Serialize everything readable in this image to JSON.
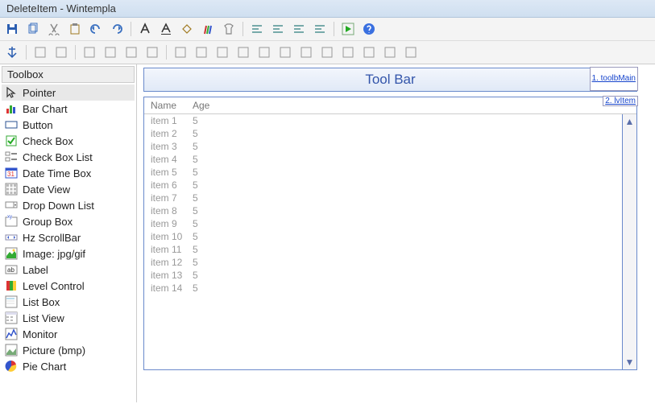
{
  "window": {
    "title": "DeleteItem  -  Wintempla"
  },
  "toolbar1_icons": [
    "save",
    "copy",
    "cut",
    "paste",
    "undo",
    "redo",
    "sep",
    "font-a",
    "font-underline",
    "fill",
    "pencils",
    "tshirt",
    "sep",
    "align-left",
    "align-center",
    "align-right",
    "align-stack",
    "sep",
    "play-green",
    "help"
  ],
  "toolbar2_icons": [
    "anchor",
    "sep",
    "h-align-top",
    "h-align-bottom",
    "sep",
    "v-align-left",
    "v-align-right",
    "arrows-out",
    "arrows-v",
    "sep",
    "bars-1",
    "bars-2",
    "bars-3",
    "bars-4",
    "grid-1",
    "grid-2",
    "grid-3",
    "grid-4",
    "grid-5",
    "grid-6",
    "grid-7",
    "grid-8"
  ],
  "sidebar": {
    "title": "Toolbox",
    "items": [
      {
        "icon": "cursor",
        "label": "Pointer",
        "selected": true
      },
      {
        "icon": "barchart",
        "label": "Bar Chart"
      },
      {
        "icon": "button",
        "label": "Button"
      },
      {
        "icon": "checkbox",
        "label": "Check Box"
      },
      {
        "icon": "checklist",
        "label": "Check Box List"
      },
      {
        "icon": "calendar",
        "label": "Date Time Box"
      },
      {
        "icon": "dategrid",
        "label": "Date View"
      },
      {
        "icon": "dropdown",
        "label": "Drop Down List"
      },
      {
        "icon": "groupbox",
        "label": "Group Box"
      },
      {
        "icon": "hscroll",
        "label": "Hz ScrollBar"
      },
      {
        "icon": "image",
        "label": "Image: jpg/gif"
      },
      {
        "icon": "label",
        "label": "Label"
      },
      {
        "icon": "level",
        "label": "Level Control"
      },
      {
        "icon": "listbox",
        "label": "List Box"
      },
      {
        "icon": "listview",
        "label": "List View"
      },
      {
        "icon": "monitor",
        "label": "Monitor"
      },
      {
        "icon": "picture",
        "label": "Picture (bmp)"
      },
      {
        "icon": "pie",
        "label": "Pie Chart"
      }
    ]
  },
  "canvas": {
    "toolbar_widget": {
      "title": "Tool Bar",
      "tag": "1. toolbMain"
    },
    "list_widget": {
      "tag": "2. lvItem",
      "columns": [
        "Name",
        "Age"
      ],
      "rows": [
        {
          "name": "item 1",
          "age": "5"
        },
        {
          "name": "item 2",
          "age": "5"
        },
        {
          "name": "item 3",
          "age": "5"
        },
        {
          "name": "item 4",
          "age": "5"
        },
        {
          "name": "item 5",
          "age": "5"
        },
        {
          "name": "item 6",
          "age": "5"
        },
        {
          "name": "item 7",
          "age": "5"
        },
        {
          "name": "item 8",
          "age": "5"
        },
        {
          "name": "item 9",
          "age": "5"
        },
        {
          "name": "item 10",
          "age": "5"
        },
        {
          "name": "item 11",
          "age": "5"
        },
        {
          "name": "item 12",
          "age": "5"
        },
        {
          "name": "item 13",
          "age": "5"
        },
        {
          "name": "item 14",
          "age": "5"
        }
      ]
    }
  }
}
